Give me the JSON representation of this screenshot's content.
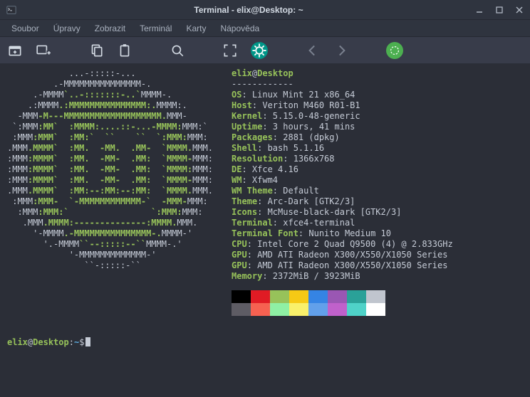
{
  "window": {
    "title": "Terminal - elix@Desktop: ~"
  },
  "menu": {
    "items": [
      "Soubor",
      "Úpravy",
      "Zobrazit",
      "Terminál",
      "Karty",
      "Nápověda"
    ]
  },
  "neofetch": {
    "user": "elix",
    "host": "Desktop",
    "separator": "------------",
    "entries": [
      {
        "label": "OS",
        "value": "Linux Mint 21 x86_64"
      },
      {
        "label": "Host",
        "value": "Veriton M460 R01-B1"
      },
      {
        "label": "Kernel",
        "value": "5.15.0-48-generic"
      },
      {
        "label": "Uptime",
        "value": "3 hours, 41 mins"
      },
      {
        "label": "Packages",
        "value": "2881 (dpkg)"
      },
      {
        "label": "Shell",
        "value": "bash 5.1.16"
      },
      {
        "label": "Resolution",
        "value": "1366x768"
      },
      {
        "label": "DE",
        "value": "Xfce 4.16"
      },
      {
        "label": "WM",
        "value": "Xfwm4"
      },
      {
        "label": "WM Theme",
        "value": "Default"
      },
      {
        "label": "Theme",
        "value": "Arc-Dark [GTK2/3]"
      },
      {
        "label": "Icons",
        "value": "McMuse-black-dark [GTK2/3]"
      },
      {
        "label": "Terminal",
        "value": "xfce4-terminal"
      },
      {
        "label": "Terminal Font",
        "value": "Nunito Medium 10"
      },
      {
        "label": "CPU",
        "value": "Intel Core 2 Quad Q9500 (4) @ 2.833GHz"
      },
      {
        "label": "GPU",
        "value": "AMD ATI Radeon X300/X550/X1050 Series"
      },
      {
        "label": "GPU",
        "value": "AMD ATI Radeon X300/X550/X1050 Series"
      },
      {
        "label": "Memory",
        "value": "2372MiB / 3923MiB"
      }
    ],
    "palette": [
      "#000000",
      "#e01b24",
      "#97c25a",
      "#f6c915",
      "#3584e4",
      "#9a57b3",
      "#2aa198",
      "#c0c5ce",
      "#5e5c64",
      "#f66151",
      "#8ff0a4",
      "#f9f06b",
      "#62a0ea",
      "#c061cb",
      "#4fd2c8",
      "#ffffff"
    ]
  },
  "prompt": {
    "user": "elix",
    "host": "Desktop",
    "path": "~",
    "symbol": "$"
  }
}
